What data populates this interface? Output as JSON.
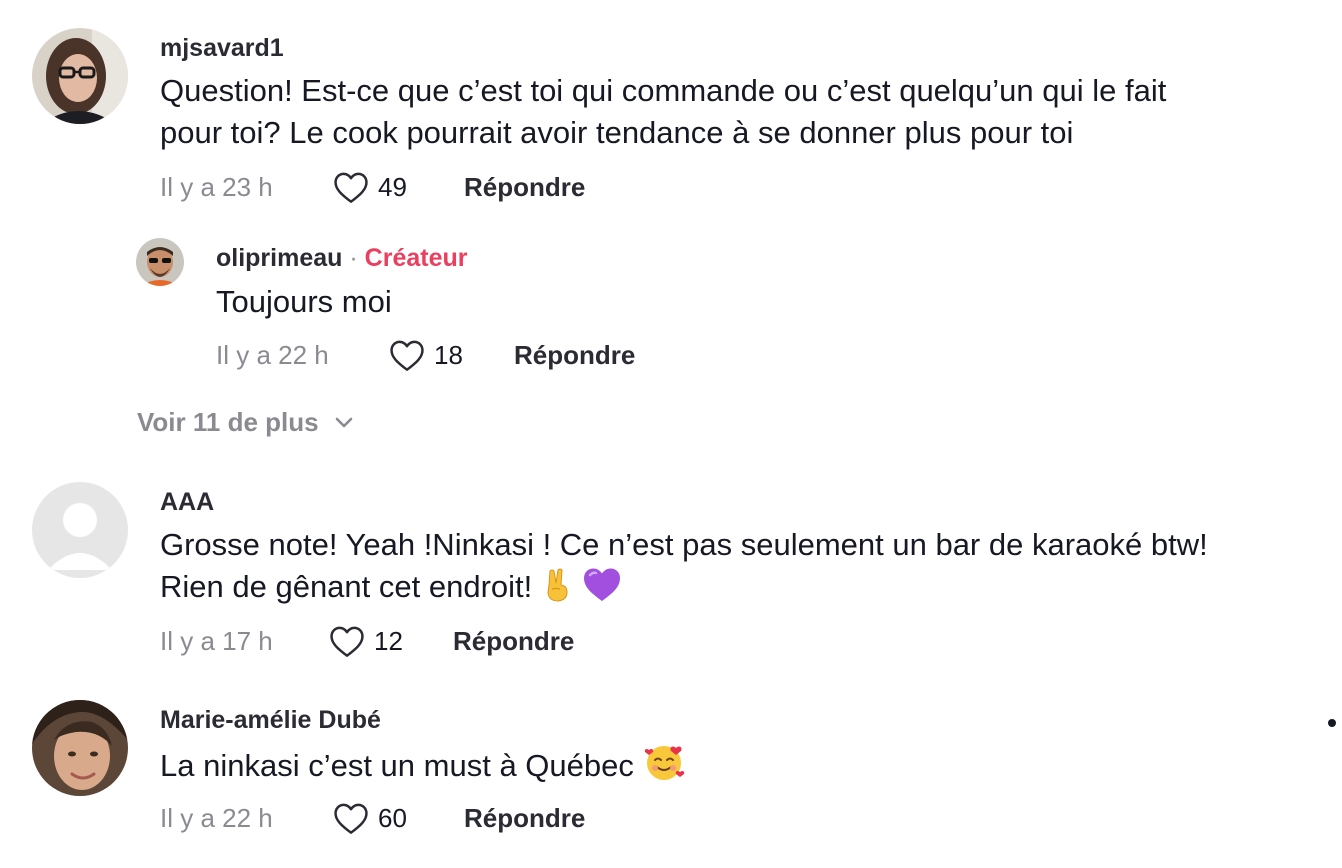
{
  "comments": [
    {
      "username": "mjsavard1",
      "text_line1": "Question! Est-ce que c’est toi qui commande ou c’est quelqu’un qui le fait",
      "text_line2": "pour toi? Le cook pourrait avoir tendance à se donner plus pour toi",
      "time": "Il y a 23 h",
      "likes": "49",
      "reply_label": "Répondre",
      "replies": [
        {
          "username": "oliprimeau",
          "separator": "·",
          "badge": "Créateur",
          "text": "Toujours moi",
          "time": "Il y a 22 h",
          "likes": "18",
          "reply_label": "Répondre"
        }
      ],
      "view_more": "Voir 11 de plus"
    },
    {
      "username": "AAA",
      "text_line1": "Grosse note! Yeah !Ninkasi ! Ce n’est pas seulement un bar de karaoké btw!",
      "text_line2": "Rien de gênant cet endroit!",
      "emojis": [
        "victory-hand",
        "purple-heart"
      ],
      "time": "Il y a 17 h",
      "likes": "12",
      "reply_label": "Répondre"
    },
    {
      "username": "Marie-amélie Dubé",
      "text_line1": "La ninkasi c’est un must à Québec",
      "emojis": [
        "smiling-face-with-hearts"
      ],
      "time": "Il y a 22 h",
      "likes": "60",
      "reply_label": "Répondre"
    }
  ],
  "icons": {
    "like": "heart-outline-icon",
    "expand": "chevron-down-icon"
  },
  "colors": {
    "creator_badge": "#ea3f5f",
    "muted": "#8a8b91",
    "text": "#161823"
  }
}
